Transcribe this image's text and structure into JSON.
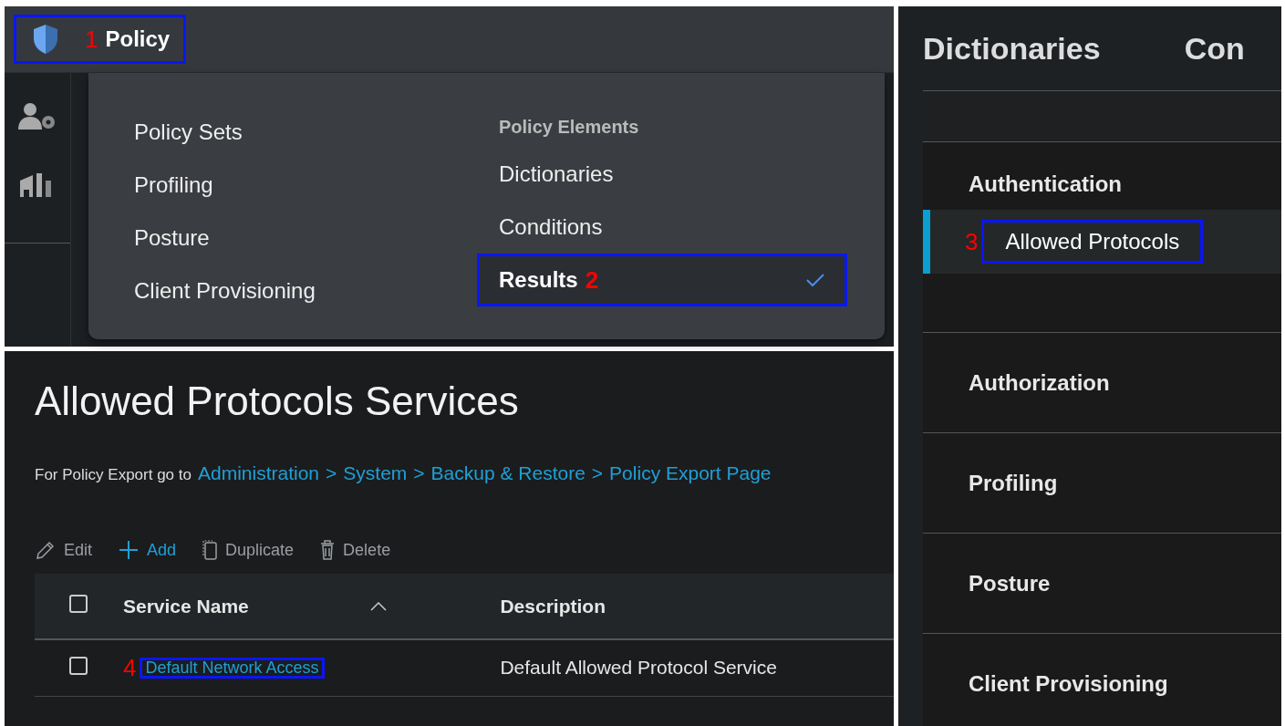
{
  "policy_menu": {
    "title": "Policy",
    "step": "1",
    "highlighted": true,
    "left_items": [
      {
        "label": "Policy Sets"
      },
      {
        "label": "Profiling"
      },
      {
        "label": "Posture"
      },
      {
        "label": "Client Provisioning"
      }
    ],
    "elements_heading": "Policy Elements",
    "right_items": [
      {
        "label": "Dictionaries",
        "selected": false,
        "highlighted": false
      },
      {
        "label": "Conditions",
        "selected": false,
        "highlighted": false
      },
      {
        "label": "Results",
        "selected": true,
        "highlighted": true,
        "step": "2"
      }
    ]
  },
  "results_nav": {
    "tabs": [
      {
        "label": "Dictionaries"
      },
      {
        "label": "Con"
      }
    ],
    "sections": [
      {
        "title": "Authentication",
        "items": [
          {
            "label": "Allowed Protocols",
            "selected": true,
            "highlighted": true,
            "step": "3"
          }
        ]
      },
      {
        "title": "Authorization"
      },
      {
        "title": "Profiling"
      },
      {
        "title": "Posture"
      },
      {
        "title": "Client Provisioning"
      }
    ]
  },
  "page": {
    "title": "Allowed Protocols Services",
    "export_note": {
      "prefix": "For Policy Export go to",
      "links": [
        "Administration",
        "System",
        "Backup & Restore",
        "Policy Export Page"
      ],
      "separator": ">"
    },
    "toolbar": [
      {
        "label": "Edit",
        "kind": "edit",
        "disabled": true
      },
      {
        "label": "Add",
        "kind": "add",
        "disabled": false
      },
      {
        "label": "Duplicate",
        "kind": "duplicate",
        "disabled": true
      },
      {
        "label": "Delete",
        "kind": "delete",
        "disabled": true
      }
    ],
    "table": {
      "select_all_checked": false,
      "columns": [
        {
          "label": "Service Name",
          "sorted": true
        },
        {
          "label": "Description",
          "sorted": false
        }
      ],
      "rows": [
        {
          "checked": false,
          "service_name": "Default Network Access",
          "description": "Default Allowed Protocol Service",
          "step": "4",
          "highlighted": true
        }
      ]
    }
  }
}
